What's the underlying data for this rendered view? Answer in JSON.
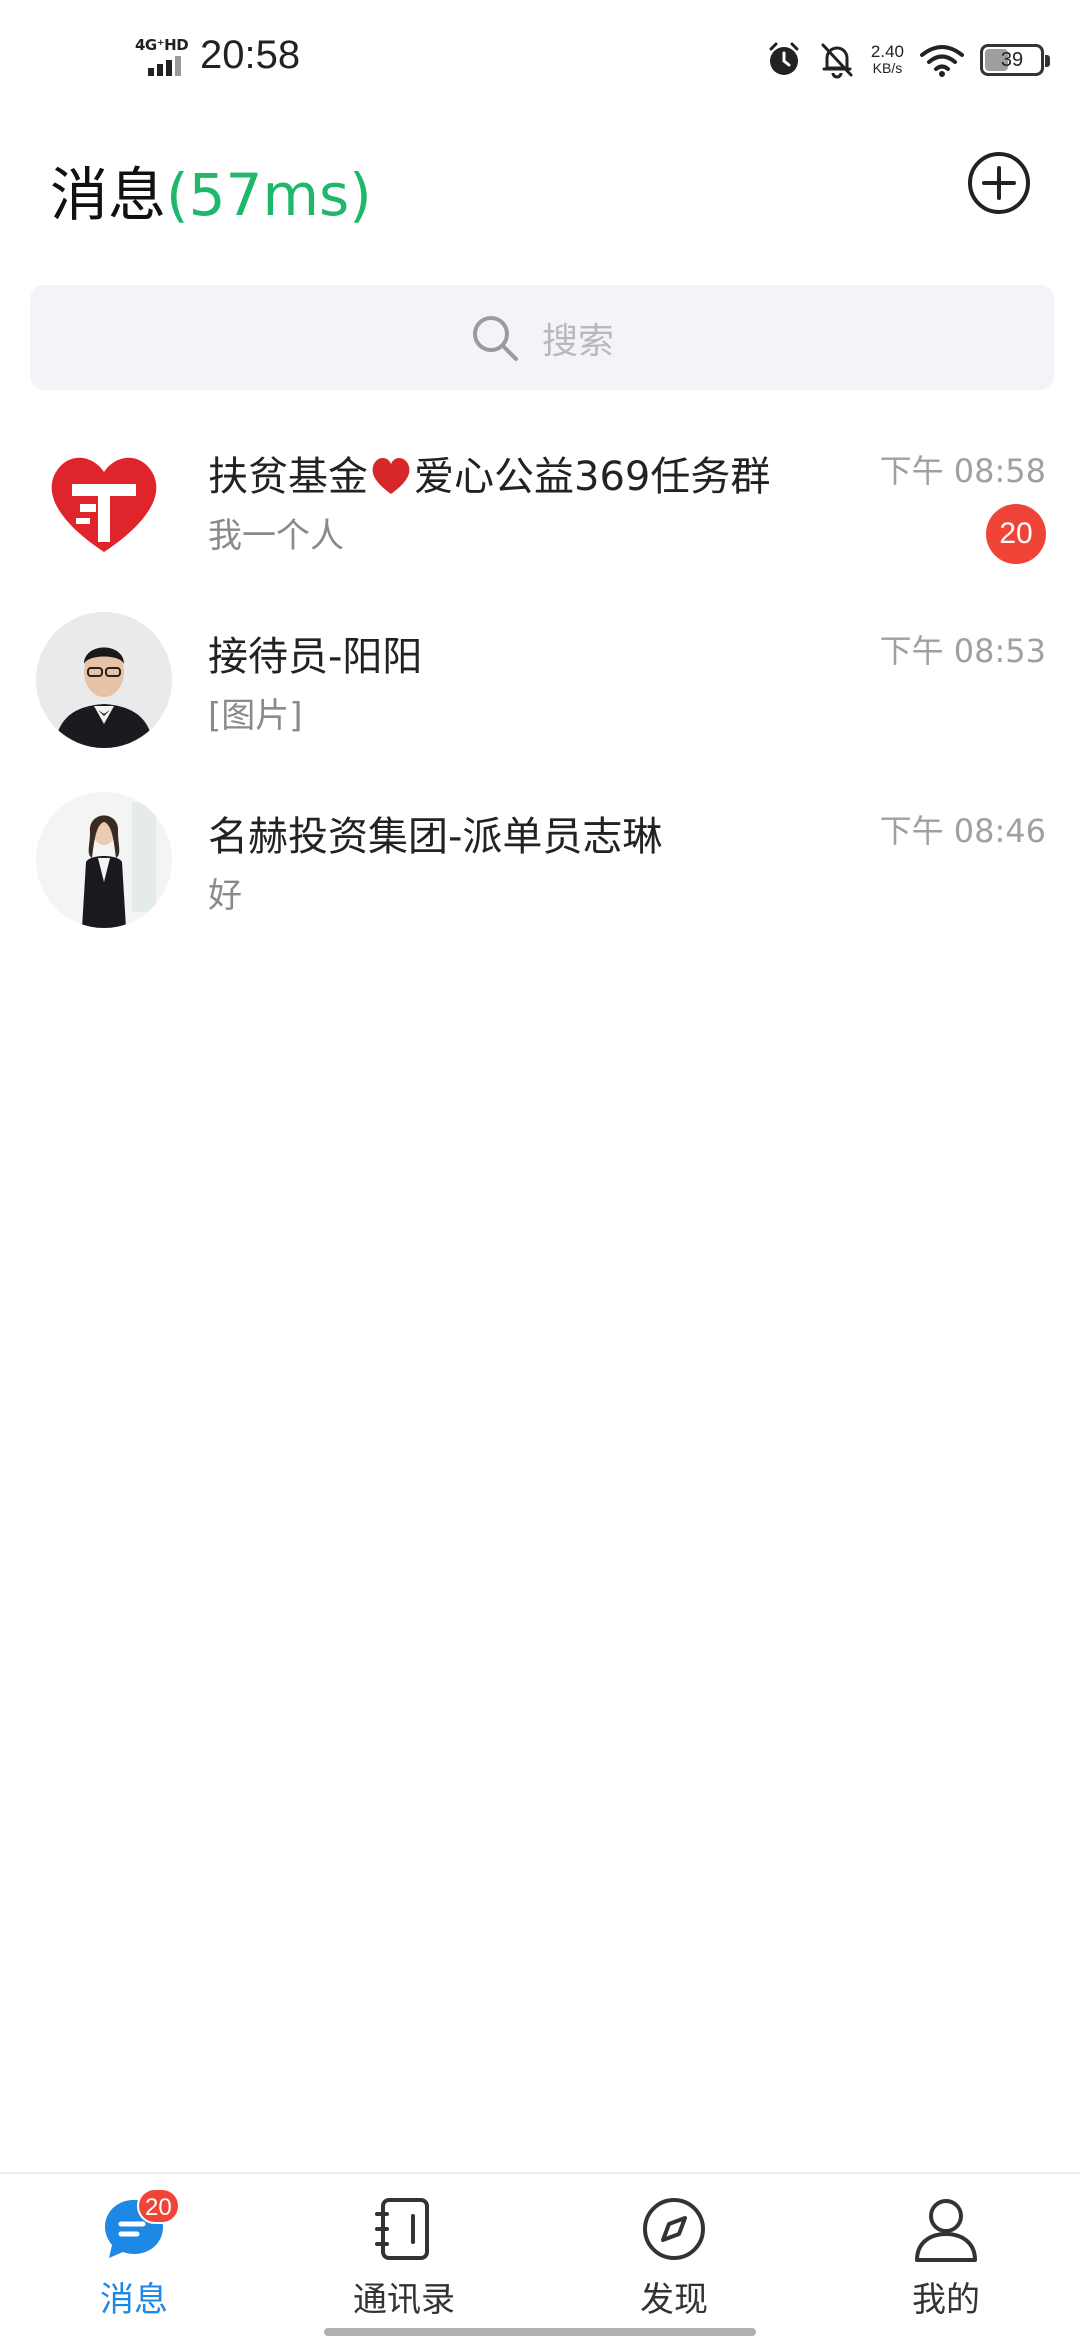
{
  "status_bar": {
    "network": "4G⁺HD",
    "time": "20:58",
    "speed_value": "2.40",
    "speed_unit": "KB/s",
    "battery": "39",
    "battery_level": 0.39
  },
  "header": {
    "title": "消息",
    "ping": "(57ms)"
  },
  "search": {
    "placeholder": "搜索"
  },
  "chats": [
    {
      "name_part1": "扶贫基金",
      "name_part2": "爱心公益369任务群",
      "preview": "我一个人",
      "time": "下午  08:58",
      "unread": "20",
      "avatar": "heart-logo-icon"
    },
    {
      "name": "接待员-阳阳",
      "preview": "[图片]",
      "time": "下午  08:53",
      "avatar": "man-in-suit-photo"
    },
    {
      "name": "名赫投资集团-派单员志琳",
      "preview": "好",
      "time": "下午  08:46",
      "avatar": "woman-in-suit-photo"
    }
  ],
  "nav": {
    "messages": "消息",
    "messages_badge": "20",
    "contacts": "通讯录",
    "discover": "发现",
    "me": "我的"
  },
  "colors": {
    "accent_blue": "#1e88e5",
    "ping_green": "#1fb86a",
    "badge_red": "#f04438"
  }
}
